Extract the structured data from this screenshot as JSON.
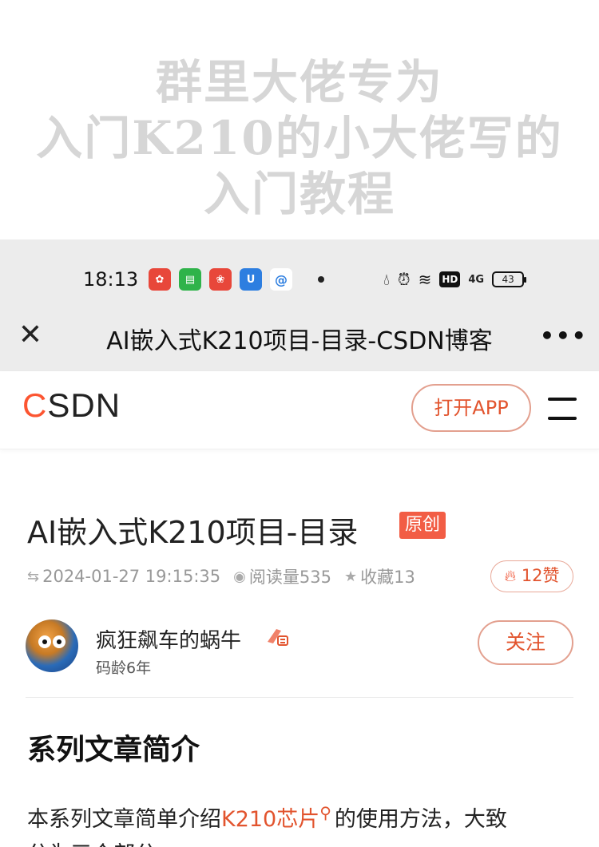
{
  "overlay_caption": {
    "line1": "群里大佬专为",
    "line2": "入门K210的小大佬写的",
    "line3": "入门教程"
  },
  "status_bar": {
    "time": "18:13",
    "app_icons": [
      {
        "name": "app-icon-1",
        "color": "#e8473a"
      },
      {
        "name": "app-icon-2",
        "color": "#2fb34a"
      },
      {
        "name": "app-icon-3",
        "color": "#e8473a"
      },
      {
        "name": "app-icon-4",
        "color": "#2d7ee0"
      },
      {
        "name": "app-icon-5",
        "color": "#2d7ee0"
      }
    ],
    "hd": "HD",
    "signal": "4G",
    "battery": "43"
  },
  "browser_bar": {
    "title": "AI嵌入式K210项目-目录-CSDN博客",
    "more": "•••"
  },
  "csdn_header": {
    "logo_c": "C",
    "logo_rest": "SDN",
    "open_app": "打开APP",
    "accent": "#fc5531"
  },
  "article": {
    "title": "AI嵌入式K210项目-目录",
    "original_badge": "原创",
    "date": "2024-01-27 19:15:35",
    "reads": "阅读量535",
    "favorites": "收藏13",
    "likes": "12赞"
  },
  "author": {
    "name": "疯狂飙车的蜗牛",
    "age": "码龄6年",
    "follow": "关注"
  },
  "content": {
    "section_title": "系列文章简介",
    "line1_prefix": "本系列文章简单介绍",
    "line1_link": "K210芯片",
    "line1_suffix": "的使用方法，大致",
    "line2": "分为三个部分，"
  }
}
